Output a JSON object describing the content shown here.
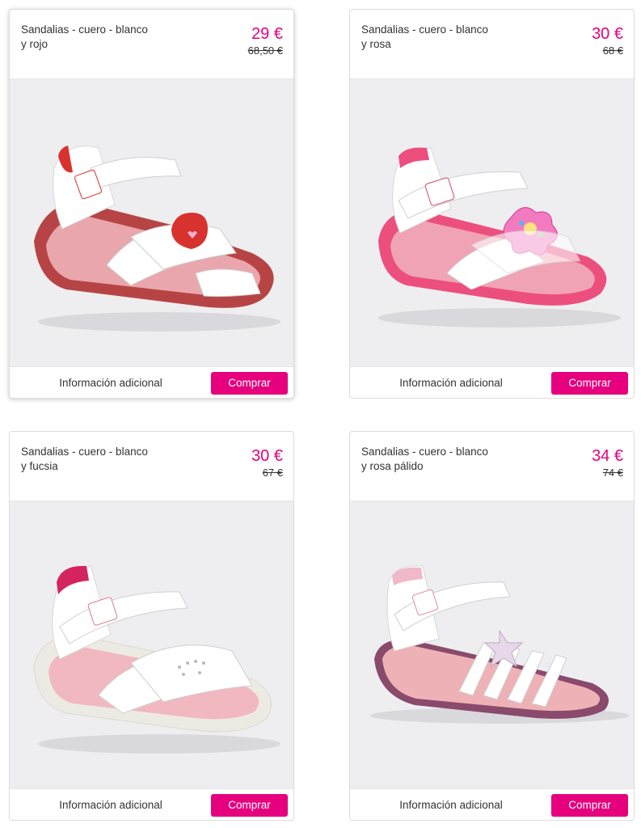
{
  "products": [
    {
      "title_line1": "Sandalias - cuero - blanco",
      "title_line2": "y rojo",
      "price": "29 €",
      "old_price": "68,50 €",
      "info_label": "Información adicional",
      "buy_label": "Comprar",
      "image_alt": "sandal-white-red-apple",
      "colors": {
        "sole": "#b74444",
        "insole": "#e9a7ad",
        "strap": "#ffffff",
        "accent": "#d8322f"
      }
    },
    {
      "title_line1": "Sandalias - cuero - blanco",
      "title_line2": "y rosa",
      "price": "30 €",
      "old_price": "68 €",
      "info_label": "Información adicional",
      "buy_label": "Comprar",
      "image_alt": "sandal-white-pink-flower",
      "colors": {
        "sole": "#ec4f7e",
        "insole": "#f0a3b4",
        "strap": "#ffffff",
        "accent": "#f27bc0"
      }
    },
    {
      "title_line1": "Sandalias - cuero - blanco",
      "title_line2": "y fucsia",
      "price": "30 €",
      "old_price": "67 €",
      "info_label": "Información adicional",
      "buy_label": "Comprar",
      "image_alt": "sandal-white-fuchsia",
      "colors": {
        "sole": "#ecebe3",
        "insole": "#f2b8c0",
        "strap": "#ffffff",
        "accent": "#d4245f"
      }
    },
    {
      "title_line1": "Sandalias - cuero - blanco",
      "title_line2": "y rosa pálido",
      "price": "34 €",
      "old_price": "74 €",
      "info_label": "Información adicional",
      "buy_label": "Comprar",
      "image_alt": "sandal-white-pale-pink-star",
      "colors": {
        "sole": "#8a4a6c",
        "insole": "#eeb2b6",
        "strap": "#ffffff",
        "accent": "#e8d6ea"
      }
    }
  ]
}
